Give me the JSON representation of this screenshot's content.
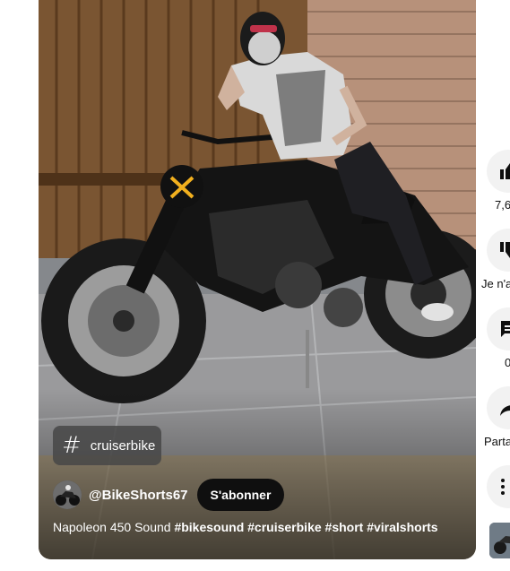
{
  "video": {
    "tag_chip": {
      "icon": "hashtag-icon",
      "label": "cruiserbike"
    },
    "channel": {
      "handle": "@BikeShorts67",
      "avatar_icon": "motorcycle-avatar"
    },
    "subscribe_label": "S'abonner",
    "caption": {
      "text": "Napoleon 450 Sound",
      "hashtags": [
        "#bikesound",
        "#cruiserbike",
        "#short",
        "#viralshorts"
      ]
    }
  },
  "actions": {
    "like": {
      "icon": "thumbs-up-icon",
      "count": "7,6"
    },
    "dislike": {
      "icon": "thumbs-down-icon",
      "label": "Je n'a"
    },
    "comments": {
      "icon": "comment-icon",
      "count": "0"
    },
    "share": {
      "icon": "share-icon",
      "label": "Parta"
    },
    "more": {
      "icon": "more-vertical-icon"
    }
  },
  "colors": {
    "subscribe_bg": "#0f0f0f",
    "action_bg": "#f2f2f2",
    "chip_bg": "#464646"
  }
}
